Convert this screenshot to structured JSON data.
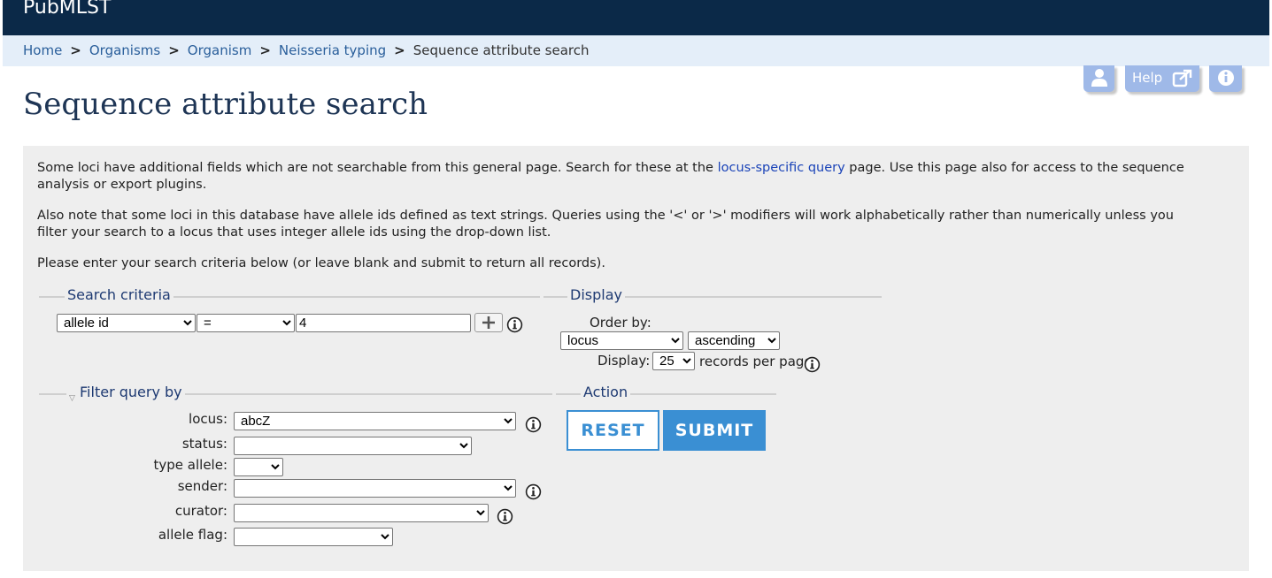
{
  "app": {
    "brand": "PubMLST"
  },
  "breadcrumb": {
    "items": [
      "Home",
      "Organisms",
      "Organism",
      "Neisseria typing"
    ],
    "current": "Sequence attribute search",
    "separator": ">"
  },
  "toolbar": {
    "help_label": "Help",
    "icons": [
      "user-icon",
      "external-link-icon",
      "info-icon"
    ]
  },
  "page": {
    "title": "Sequence attribute search"
  },
  "intro": {
    "p1_before": "Some loci have additional fields which are not searchable from this general page. Search for these at the ",
    "p1_link": "locus-specific query",
    "p1_after": " page. Use this page also for access to the sequence analysis or export plugins.",
    "p2": "Also note that some loci in this database have allele ids defined as text strings. Queries using the '<' or '>' modifiers will work alphabetically rather than numerically unless you filter your search to a locus that uses integer allele ids using the drop-down list.",
    "p3": "Please enter your search criteria below (or leave blank and submit to return all records)."
  },
  "search_criteria": {
    "legend": "Search criteria",
    "field": "allele id",
    "operator": "=",
    "value": "4"
  },
  "display": {
    "legend": "Display",
    "order_by_label": "Order by:",
    "order_by_value": "locus",
    "direction_value": "ascending",
    "display_label": "Display:",
    "per_page_value": "25",
    "per_page_suffix": "records per page"
  },
  "filter": {
    "legend": "Filter query by",
    "locus_label": "locus:",
    "locus_value": "abcZ",
    "status_label": "status:",
    "type_allele_label": "type allele:",
    "sender_label": "sender:",
    "curator_label": "curator:",
    "allele_flag_label": "allele flag:"
  },
  "action": {
    "legend": "Action",
    "reset_label": "RESET",
    "submit_label": "SUBMIT"
  },
  "colors": {
    "topbar": "#0b2948",
    "crumbbar": "#e4eef9",
    "link": "#2a5f9b",
    "accent": "#3a8fd3",
    "panel": "#eeeeee"
  }
}
